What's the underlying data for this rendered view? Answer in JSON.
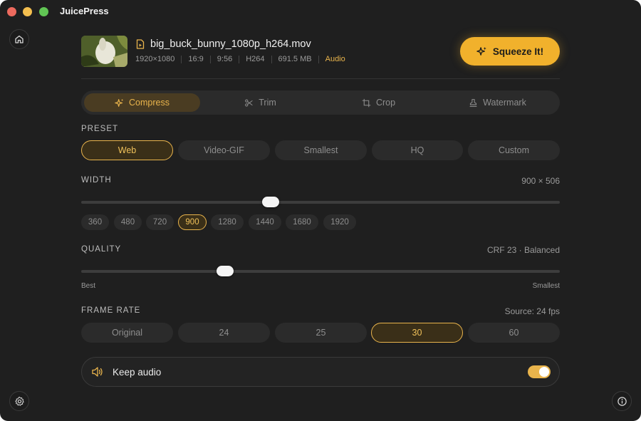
{
  "app": {
    "title": "JuicePress"
  },
  "file": {
    "name": "big_buck_bunny_1080p_h264.mov",
    "meta": [
      "1920×1080",
      "16:9",
      "9:56",
      "H264",
      "691.5 MB",
      "Audio"
    ]
  },
  "actions": {
    "squeeze_label": "Squeeze It!"
  },
  "tabs": [
    {
      "label": "Compress",
      "icon": "sparkle-icon",
      "active": true
    },
    {
      "label": "Trim",
      "icon": "scissors-icon",
      "active": false
    },
    {
      "label": "Crop",
      "icon": "crop-icon",
      "active": false
    },
    {
      "label": "Watermark",
      "icon": "stamp-icon",
      "active": false
    }
  ],
  "preset": {
    "label": "PRESET",
    "options": [
      "Web",
      "Video-GIF",
      "Smallest",
      "HQ",
      "Custom"
    ],
    "selected": "Web"
  },
  "width": {
    "label": "WIDTH",
    "value_text": "900 × 506",
    "slider_fraction": 0.396,
    "options": [
      "360",
      "480",
      "720",
      "900",
      "1280",
      "1440",
      "1680",
      "1920"
    ],
    "selected": "900"
  },
  "quality": {
    "label": "QUALITY",
    "value_text": "CRF 23 · Balanced",
    "slider_fraction": 0.3,
    "min_label": "Best",
    "max_label": "Smallest"
  },
  "framerate": {
    "label": "FRAME RATE",
    "value_text": "Source: 24 fps",
    "options": [
      "Original",
      "24",
      "25",
      "30",
      "60"
    ],
    "selected": "30"
  },
  "audio": {
    "label": "Keep audio",
    "enabled": true
  },
  "colors": {
    "accent": "#f1b12c",
    "background": "#1f1f1f"
  },
  "icons": {
    "home": "home-icon",
    "settings": "gear-icon",
    "info": "info-icon"
  }
}
